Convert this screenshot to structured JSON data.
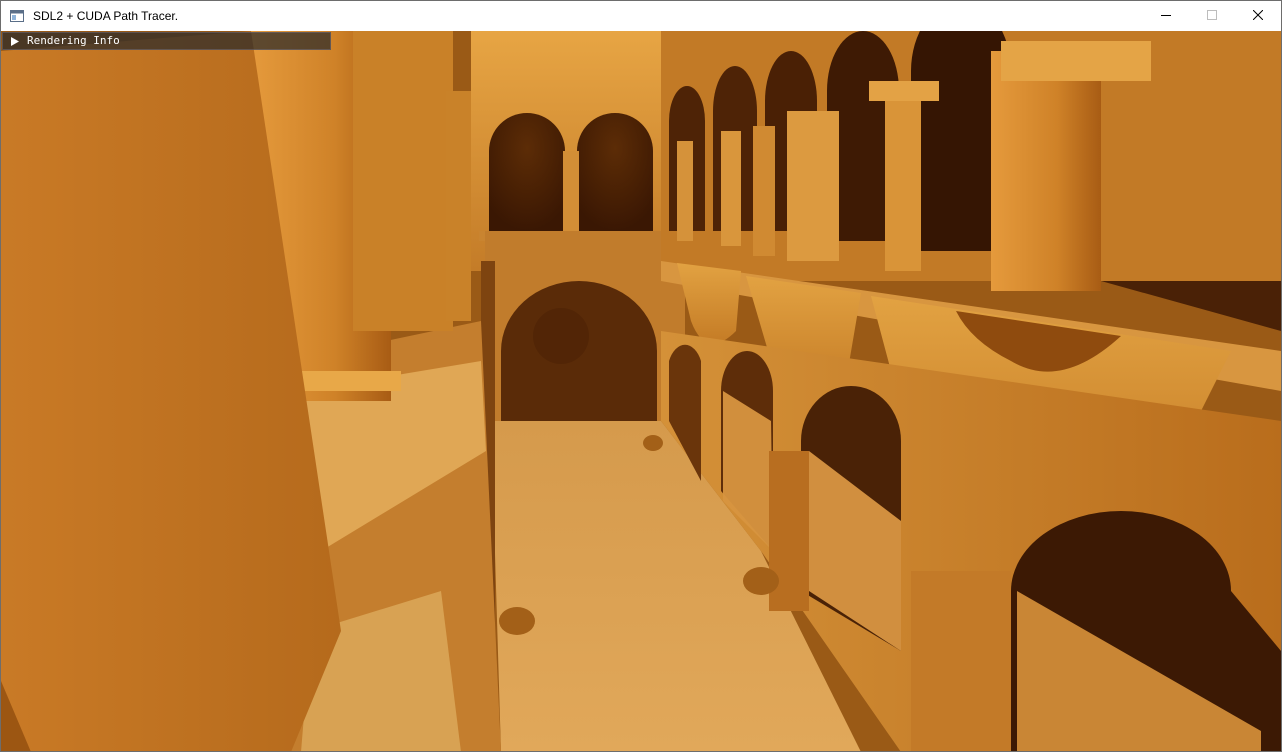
{
  "window": {
    "title": "SDL2 + CUDA Path Tracer.",
    "icon": "app-window-icon",
    "controls": [
      "minimize-icon",
      "maximize-icon",
      "close-icon"
    ]
  },
  "overlay": {
    "collapsed_panel_label": "Rendering Info",
    "arrow_icon": "triangle-right-icon"
  },
  "scene": {
    "description_icon": "path-traced-render",
    "palette": {
      "light": "#f2b04a",
      "mid": "#c67f24",
      "dark": "#7a3f0a",
      "shadow": "#2e1203"
    }
  }
}
